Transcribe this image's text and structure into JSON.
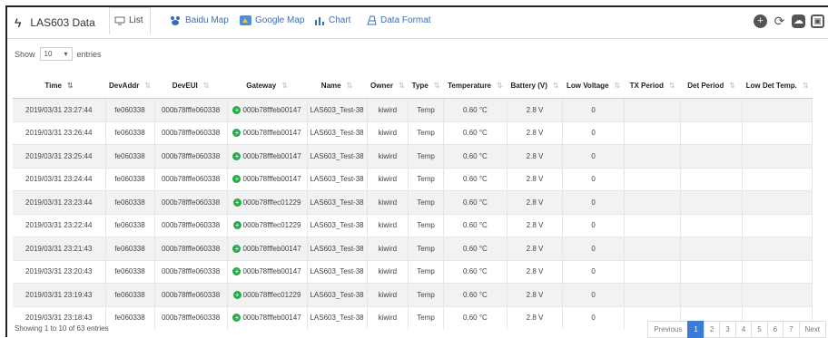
{
  "app": {
    "title": "LAS603 Data"
  },
  "tabs": [
    {
      "label": "List",
      "icon": "monitor-icon"
    },
    {
      "label": "Baidu Map",
      "icon": "baidu-map-icon"
    },
    {
      "label": "Google Map",
      "icon": "google-map-icon"
    },
    {
      "label": "Chart",
      "icon": "bar-chart-icon"
    },
    {
      "label": "Data Format",
      "icon": "format-icon"
    }
  ],
  "length": {
    "prefix": "Show",
    "value": "10",
    "suffix": "entries"
  },
  "columns": [
    "Time",
    "DevAddr",
    "DevEUI",
    "Gateway",
    "Name",
    "Owner",
    "Type",
    "Temperature",
    "Battery (V)",
    "Low Voltage",
    "TX Period",
    "Det Period",
    "Low Det Temp."
  ],
  "rows": [
    [
      "2019/03/31 23:27:44",
      "fe060338",
      "000b78fffe060338",
      "000b78fffeb00147",
      "LAS603_Test-38",
      "kiwird",
      "Temp",
      "0.60 °C",
      "2.8 V",
      "0",
      "",
      "",
      ""
    ],
    [
      "2019/03/31 23:26:44",
      "fe060338",
      "000b78fffe060338",
      "000b78fffeb00147",
      "LAS603_Test-38",
      "kiwird",
      "Temp",
      "0.60 °C",
      "2.8 V",
      "0",
      "",
      "",
      ""
    ],
    [
      "2019/03/31 23:25:44",
      "fe060338",
      "000b78fffe060338",
      "000b78fffeb00147",
      "LAS603_Test-38",
      "kiwird",
      "Temp",
      "0.60 °C",
      "2.8 V",
      "0",
      "",
      "",
      ""
    ],
    [
      "2019/03/31 23:24:44",
      "fe060338",
      "000b78fffe060338",
      "000b78fffeb00147",
      "LAS603_Test-38",
      "kiwird",
      "Temp",
      "0.60 °C",
      "2.8 V",
      "0",
      "",
      "",
      ""
    ],
    [
      "2019/03/31 23:23:44",
      "fe060338",
      "000b78fffe060338",
      "000b78fffec01229",
      "LAS603_Test-38",
      "kiwird",
      "Temp",
      "0.60 °C",
      "2.8 V",
      "0",
      "",
      "",
      ""
    ],
    [
      "2019/03/31 23:22:44",
      "fe060338",
      "000b78fffe060338",
      "000b78fffec01229",
      "LAS603_Test-38",
      "kiwird",
      "Temp",
      "0.60 °C",
      "2.8 V",
      "0",
      "",
      "",
      ""
    ],
    [
      "2019/03/31 23:21:43",
      "fe060338",
      "000b78fffe060338",
      "000b78fffeb00147",
      "LAS603_Test-38",
      "kiwird",
      "Temp",
      "0.60 °C",
      "2.8 V",
      "0",
      "",
      "",
      ""
    ],
    [
      "2019/03/31 23:20:43",
      "fe060338",
      "000b78fffe060338",
      "000b78fffeb00147",
      "LAS603_Test-38",
      "kiwird",
      "Temp",
      "0.60 °C",
      "2.8 V",
      "0",
      "",
      "",
      ""
    ],
    [
      "2019/03/31 23:19:43",
      "fe060338",
      "000b78fffe060338",
      "000b78fffec01229",
      "LAS603_Test-38",
      "kiwird",
      "Temp",
      "0.60 °C",
      "2.8 V",
      "0",
      "",
      "",
      ""
    ],
    [
      "2019/03/31 23:18:43",
      "fe060338",
      "000b78fffe060338",
      "000b78fffeb00147",
      "LAS603_Test-38",
      "kiwird",
      "Temp",
      "0.60 °C",
      "2.8 V",
      "0",
      "",
      "",
      ""
    ]
  ],
  "footer": {
    "info": "Showing 1 to 10 of 63 entries"
  },
  "pager": {
    "prev": "Previous",
    "pages": [
      "1",
      "2",
      "3",
      "4",
      "5",
      "6",
      "7"
    ],
    "current": "1",
    "next": "Next"
  },
  "colors": {
    "accent": "#3a7bd5",
    "gateway_ok": "#2aa84a"
  }
}
